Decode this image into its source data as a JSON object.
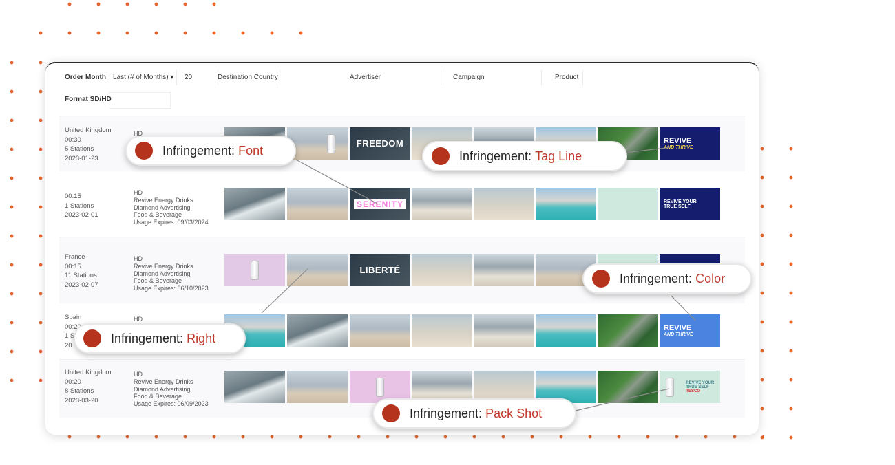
{
  "filters": {
    "order_month": "Order Month",
    "last_select": "Last (# of Months) ▾",
    "last_value": "20",
    "destination_country": "Destination Country",
    "advertiser": "Advertiser",
    "campaign": "Campaign",
    "product": "Product",
    "format": "Format SD/HD"
  },
  "rows": [
    {
      "country": "United Kingdom",
      "duration": "00:30",
      "stations": "5 Stations",
      "date": "2023-01-23",
      "format": "HD",
      "brand": "",
      "agency": "",
      "category": "",
      "expires": "",
      "thumb_text": {
        "freedom": "FREEDOM",
        "revive": "REVIVE",
        "revive_sub": "AND THRIVE"
      }
    },
    {
      "country": "",
      "duration": "00:15",
      "stations": "1 Stations",
      "date": "2023-02-01",
      "format": "HD",
      "brand": "Revive Energy Drinks",
      "agency": "Diamond Advertising",
      "category": "Food & Beverage",
      "expires": "Usage Expires: 09/03/2024",
      "thumb_text": {
        "serenity": "SERENITY",
        "revive": "REVIVE YOUR",
        "revive_sub": "TRUE SELF"
      }
    },
    {
      "country": "France",
      "duration": "00:15",
      "stations": "11 Stations",
      "date": "2023-02-07",
      "format": "HD",
      "brand": "Revive Energy Drinks",
      "agency": "Diamond Advertising",
      "category": "Food & Beverage",
      "expires": "Usage Expires: 06/10/2023",
      "thumb_text": {
        "liberte": "LIBERTÉ"
      }
    },
    {
      "country": "Spain",
      "duration": "00:20",
      "stations": "1 S",
      "date": "20",
      "format": "HD",
      "brand": "",
      "agency": "",
      "category": "",
      "expires": "",
      "thumb_text": {
        "revive": "REVIVE",
        "revive_sub": "AND THRIVE"
      }
    },
    {
      "country": "United Kingdom",
      "duration": "00:20",
      "stations": "8 Stations",
      "date": "2023-03-20",
      "format": "HD",
      "brand": "Revive Energy Drinks",
      "agency": "Diamond Advertising",
      "category": "Food & Beverage",
      "expires": "Usage Expires: 06/09/2023",
      "thumb_text": {
        "revive": "REVIVE YOUR",
        "revive_sub": "TRUE SELF",
        "tag": "TESCO"
      }
    }
  ],
  "callouts": {
    "prefix": "Infringement:",
    "font": "Font",
    "tagline": "Tag Line",
    "color": "Color",
    "right": "Right",
    "packshot": "Pack Shot"
  },
  "colors": {
    "accent": "#b5331d",
    "dots": "#e4672f",
    "navy": "#141d6e",
    "blue": "#4a84e0"
  }
}
